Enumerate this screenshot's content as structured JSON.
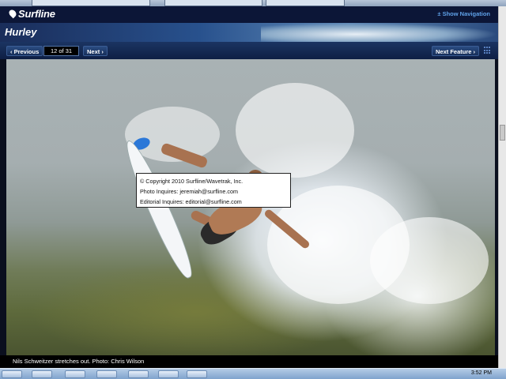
{
  "header": {
    "logo_text": "Surfline",
    "show_navigation": "± Show Navigation"
  },
  "banner": {
    "sponsor": "Hurley",
    "colors": [
      "#2a4a8a",
      "#6fbf3f",
      "#8a6fd0",
      "#d6417f",
      "#2aa0d8"
    ]
  },
  "nav": {
    "previous_label": "‹ Previous",
    "counter": "12 of 31",
    "next_label": "Next ›",
    "next_feature_label": "Next Feature ›",
    "grid_icon": "grid-icon"
  },
  "photo": {
    "copyright": {
      "line1": "© Copyright 2010 Surfline/Wavetrak, Inc.",
      "line2": "Photo Inquires: jeremiah@surfline.com",
      "line3": "Editorial Inquires: editorial@surfline.com"
    }
  },
  "caption": {
    "text": "Nils Schweitzer stretches out. Photo: Chris Wilson"
  },
  "taskbar": {
    "clock": "3:52 PM"
  }
}
